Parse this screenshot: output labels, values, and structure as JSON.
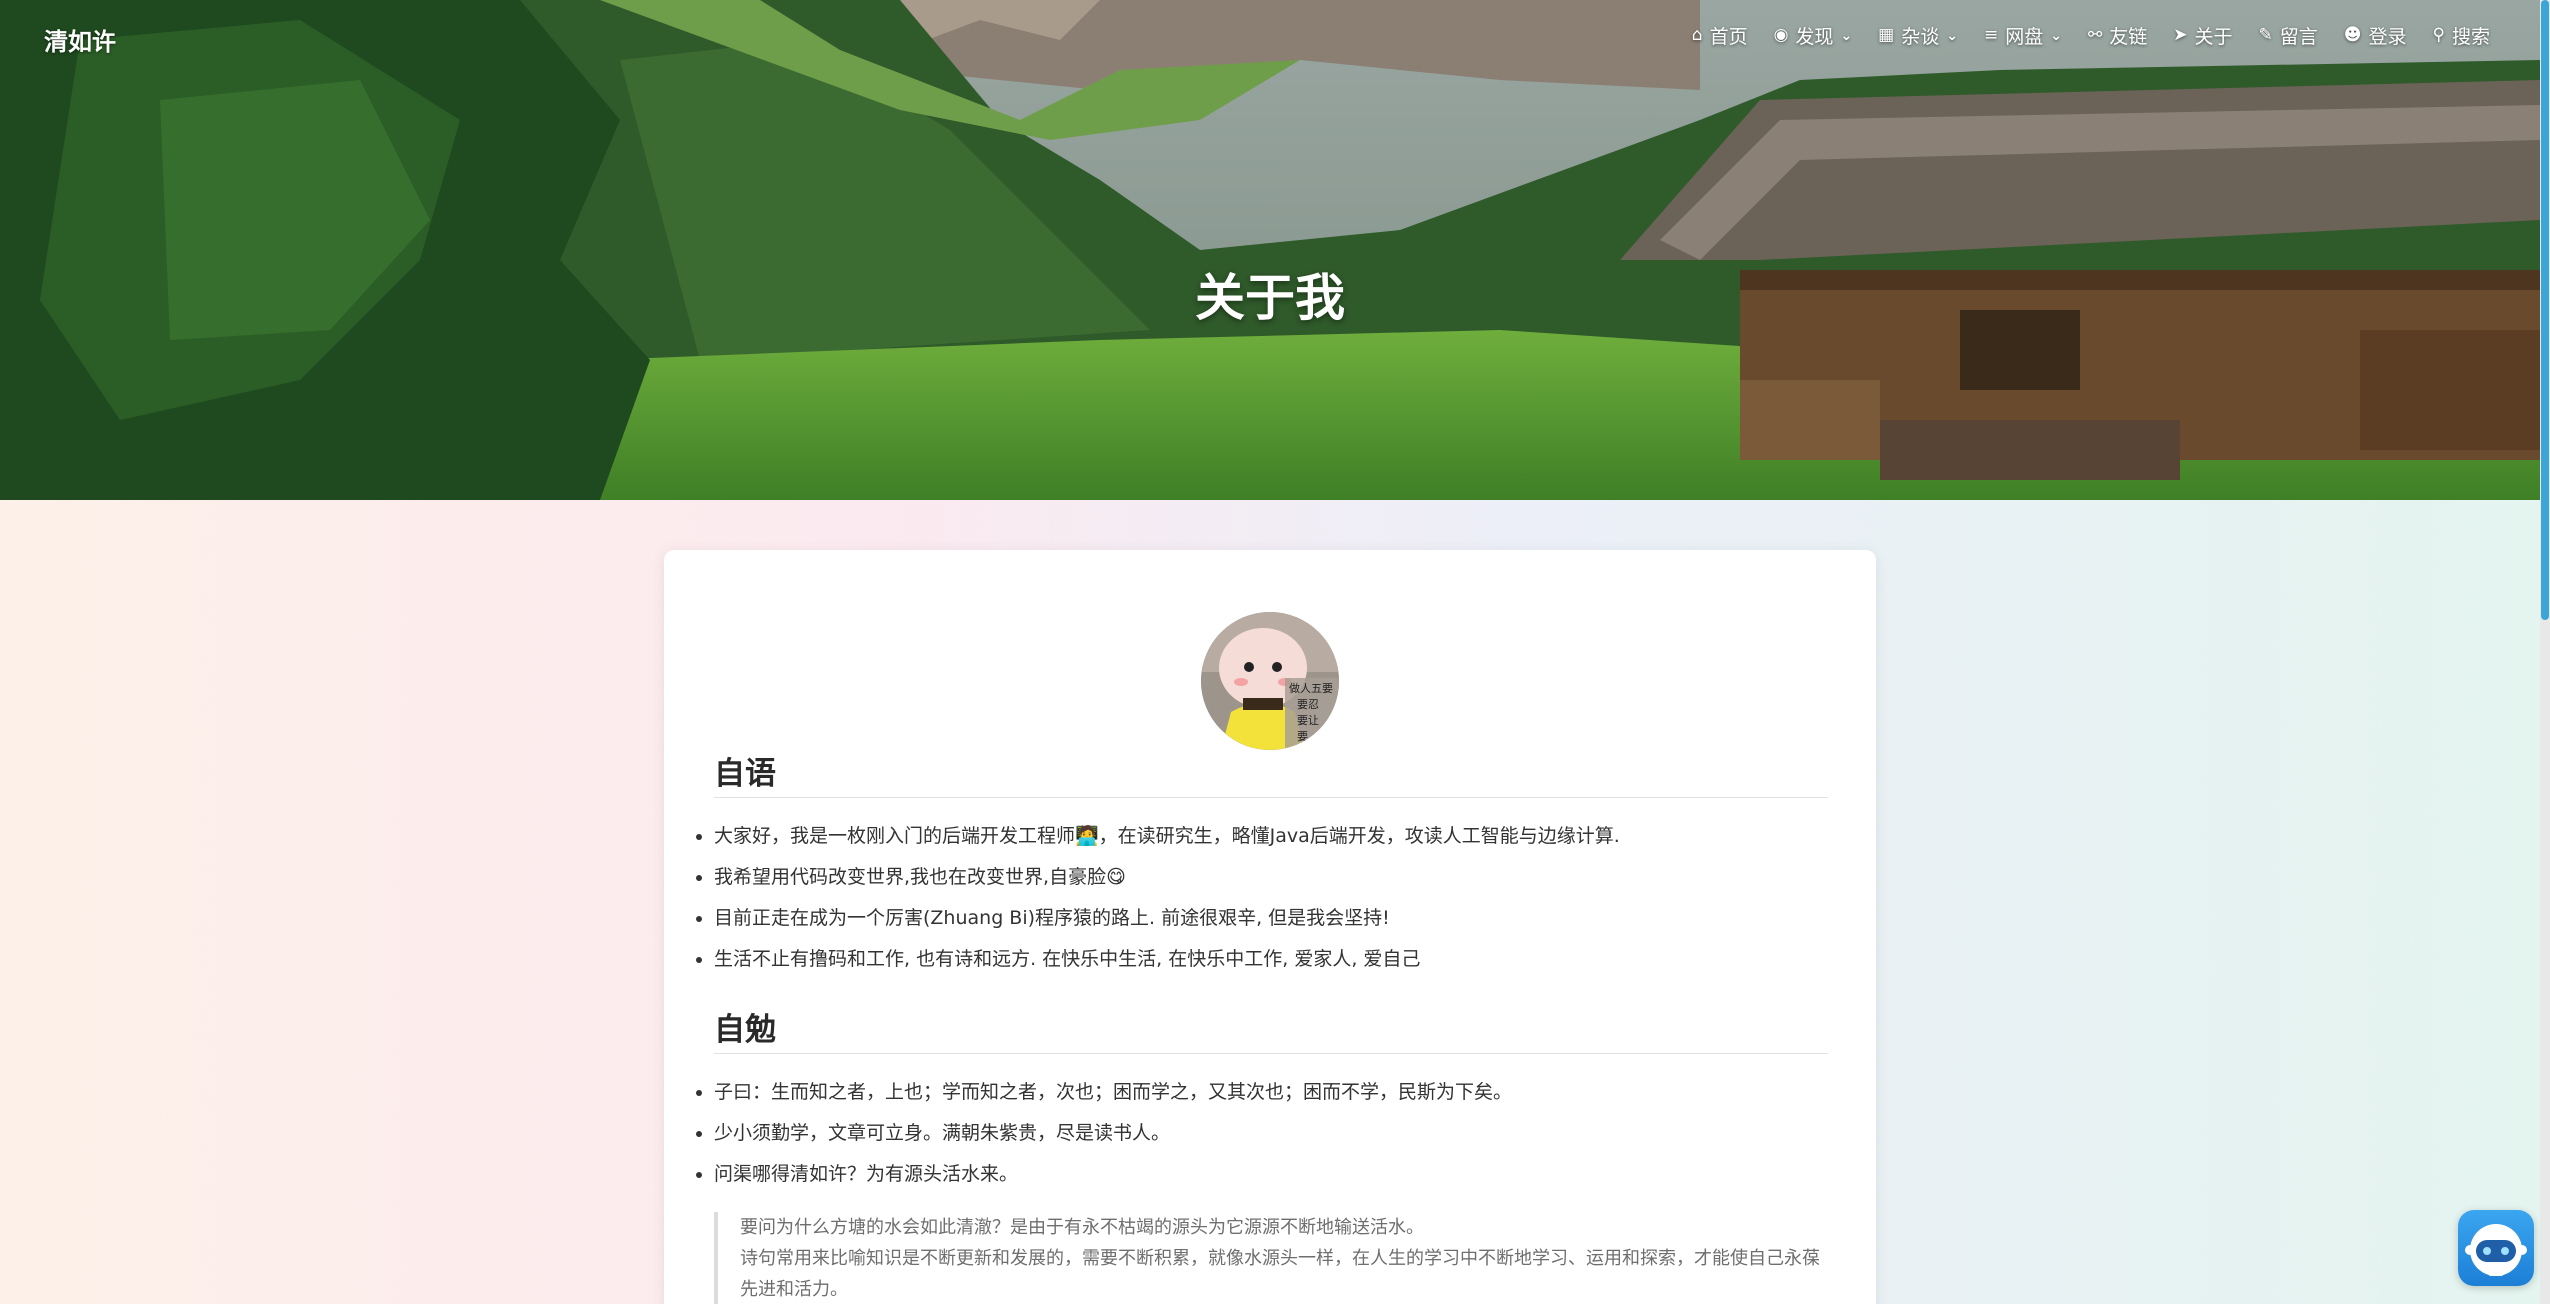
{
  "header": {
    "brand": "清如许",
    "nav": [
      {
        "label": "首页",
        "icon": "home-icon",
        "glyph": "⌂",
        "dropdown": false
      },
      {
        "label": "发现",
        "icon": "compass-icon",
        "glyph": "◉",
        "dropdown": true
      },
      {
        "label": "杂谈",
        "icon": "grid-icon",
        "glyph": "▦",
        "dropdown": true
      },
      {
        "label": "网盘",
        "icon": "list-icon",
        "glyph": "≡",
        "dropdown": true
      },
      {
        "label": "友链",
        "icon": "link-icon",
        "glyph": "⚯",
        "dropdown": false
      },
      {
        "label": "关于",
        "icon": "paper-plane-icon",
        "glyph": "➤",
        "dropdown": false
      },
      {
        "label": "留言",
        "icon": "comment-icon",
        "glyph": "✎",
        "dropdown": false
      },
      {
        "label": "登录",
        "icon": "user-icon",
        "glyph": "☻",
        "dropdown": false
      },
      {
        "label": "搜索",
        "icon": "search-icon",
        "glyph": "⚲",
        "dropdown": false
      }
    ],
    "chevron": "⌄"
  },
  "hero": {
    "title": "关于我"
  },
  "avatar": {
    "caption_lines": [
      "做人五要",
      "要忍",
      "要让",
      "要"
    ]
  },
  "sections": [
    {
      "title": "自语",
      "items": [
        "大家好，我是一枚刚入门的后端开发工程师🧑‍💻，在读研究生，略懂Java后端开发，攻读人工智能与边缘计算.",
        "我希望用代码改变世界,我也在改变世界,自豪脸😋",
        "目前正走在成为一个厉害(Zhuang Bi)程序猿的路上. 前途很艰辛, 但是我会坚持!",
        "生活不止有撸码和工作, 也有诗和远方. 在快乐中生活, 在快乐中工作, 爱家人, 爱自己"
      ]
    },
    {
      "title": "自勉",
      "items": [
        "子曰：生而知之者，上也；学而知之者，次也；困而学之，又其次也；困而不学，民斯为下矣。",
        "少小须勤学，文章可立身。满朝朱紫贵，尽是读书人。",
        "问渠哪得清如许？为有源头活水来。"
      ]
    }
  ],
  "quote": [
    "要问为什么方塘的水会如此清澈？是由于有永不枯竭的源头为它源源不断地输送活水。",
    "诗句常用来比喻知识是不断更新和发展的，需要不断积累，就像水源头一样，在人生的学习中不断地学习、运用和探索，才能使自己永葆先进和活力。"
  ],
  "colors": {
    "scrollbar_thumb": "#3aa6d8",
    "robot_widget": "#2a8fe4"
  }
}
